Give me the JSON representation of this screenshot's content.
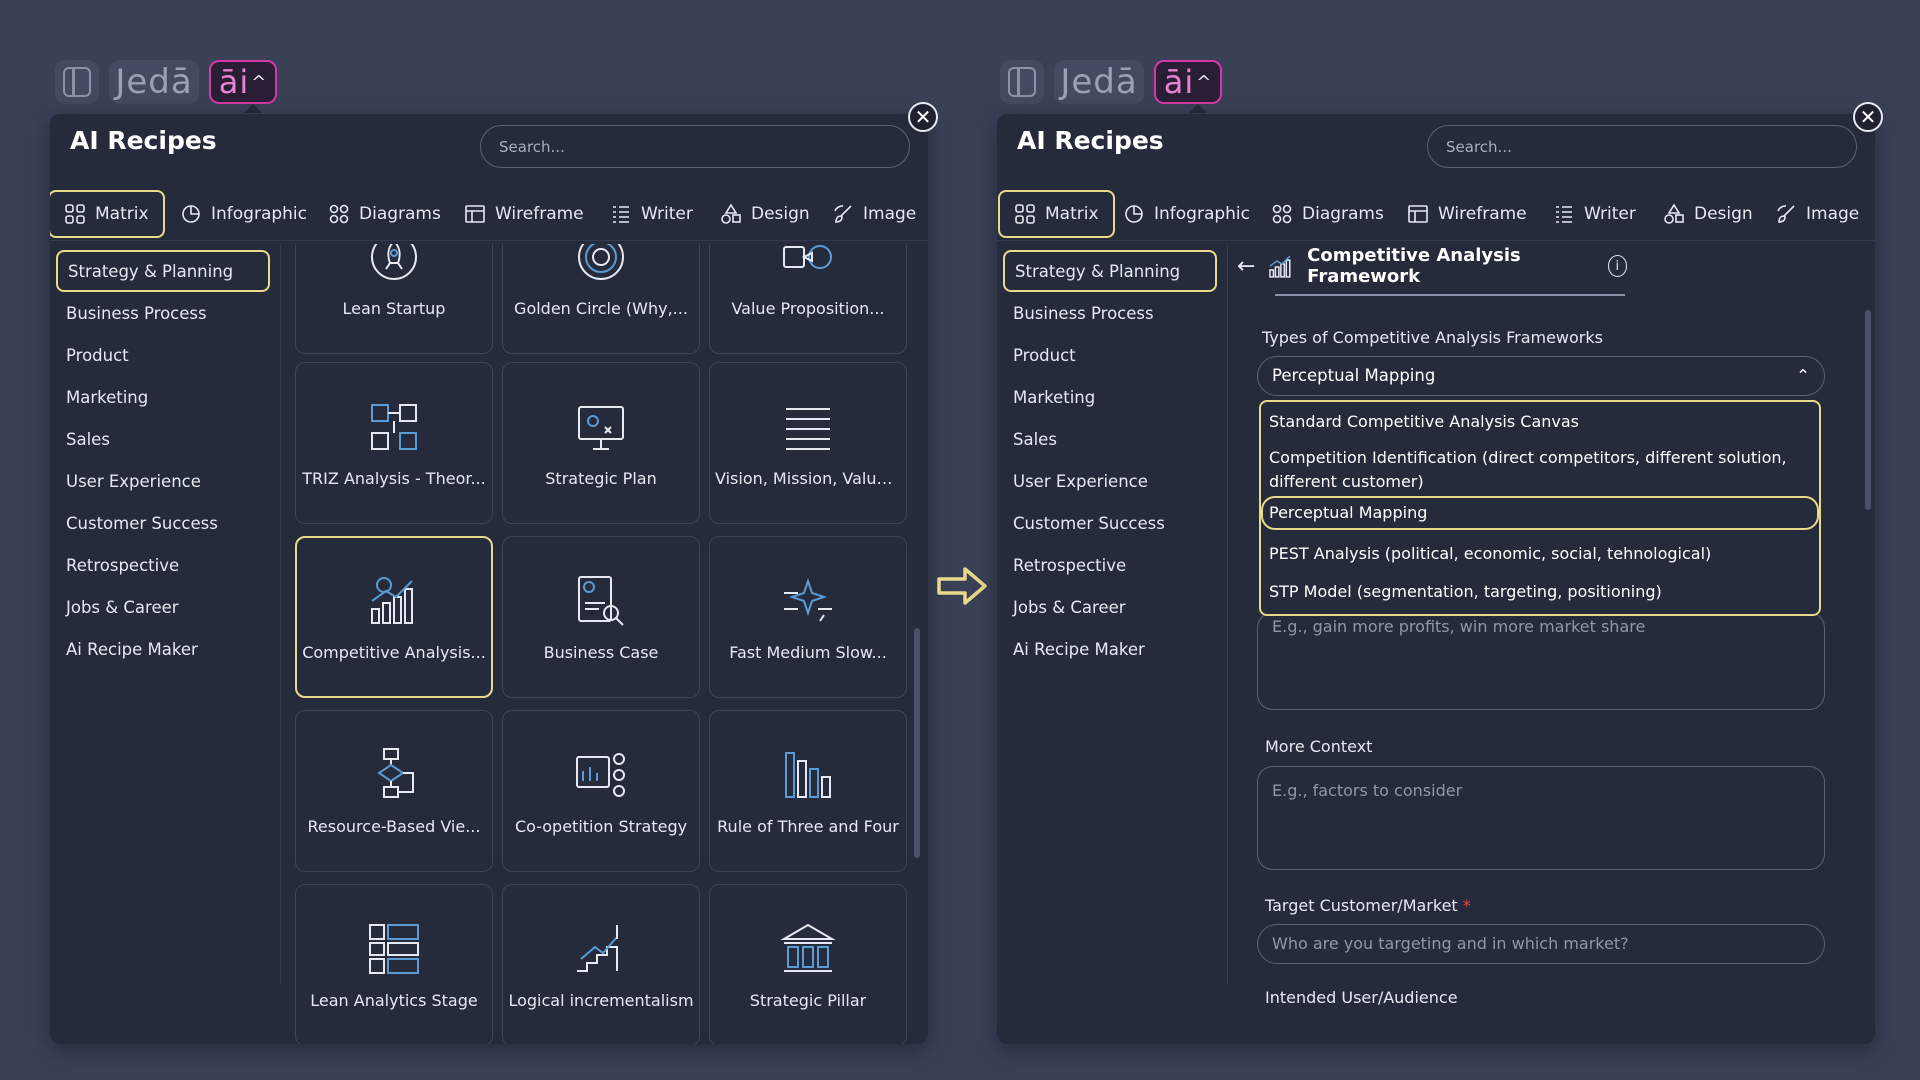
{
  "app": {
    "logo_text": "Jedā",
    "ai_button": "āi",
    "ai_caret": "^"
  },
  "panel_title": "AI Recipes",
  "search_placeholder": "Search...",
  "tabs": [
    {
      "label": "Matrix",
      "icon": "grid-icon"
    },
    {
      "label": "Infographic",
      "icon": "pie-chart-icon"
    },
    {
      "label": "Diagrams",
      "icon": "nodes-icon"
    },
    {
      "label": "Wireframe",
      "icon": "wireframe-icon"
    },
    {
      "label": "Writer",
      "icon": "lines-icon"
    },
    {
      "label": "Design",
      "icon": "shapes-icon"
    },
    {
      "label": "Image",
      "icon": "brush-icon"
    }
  ],
  "categories": [
    "Strategy & Planning",
    "Business Process",
    "Product",
    "Marketing",
    "Sales",
    "User Experience",
    "Customer Success",
    "Retrospective",
    "Jobs & Career",
    "Ai Recipe Maker"
  ],
  "recipes": [
    {
      "label": "Lean Startup",
      "icon": "rocket-icon"
    },
    {
      "label": "Golden Circle (Why,...",
      "icon": "target-circle-icon"
    },
    {
      "label": "Value Proposition...",
      "icon": "value-prop-icon"
    },
    {
      "label": "TRIZ Analysis - Theor...",
      "icon": "triz-icon"
    },
    {
      "label": "Strategic Plan",
      "icon": "strategy-board-icon"
    },
    {
      "label": "Vision, Mission, Value...",
      "icon": "text-lines-icon"
    },
    {
      "label": "Competitive Analysis...",
      "icon": "growth-chart-icon"
    },
    {
      "label": "Business Case",
      "icon": "report-search-icon"
    },
    {
      "label": "Fast Medium Slow...",
      "icon": "sparkle-icon"
    },
    {
      "label": "Resource-Based Vie...",
      "icon": "flowchart-icon"
    },
    {
      "label": "Co-opetition Strategy",
      "icon": "team-board-icon"
    },
    {
      "label": "Rule of Three and Four",
      "icon": "bars-icon"
    },
    {
      "label": "Lean Analytics Stage",
      "icon": "stages-icon"
    },
    {
      "label": "Logical incrementalism",
      "icon": "stairs-icon"
    },
    {
      "label": "Strategic Pillar",
      "icon": "pillar-icon"
    }
  ],
  "detail": {
    "back": "←",
    "title": "Competitive Analysis Framework",
    "info": "i",
    "types_label": "Types of Competitive Analysis Frameworks",
    "selected_type": "Perceptual Mapping",
    "options": [
      "Standard Competitive Analysis Canvas",
      "Competition Identification (direct competitors, different solution, different customer)",
      "Perceptual Mapping",
      "PEST Analysis (political, economic, social, tehnological)",
      "STP Model (segmentation, targeting, positioning)"
    ],
    "goal_placeholder": "E.g., gain more profits, win more market share",
    "more_context_label": "More Context",
    "more_context_placeholder": "E.g., factors to consider",
    "target_label": "Target Customer/Market",
    "required_mark": "*",
    "target_placeholder": "Who are you targeting and in which market?",
    "audience_label": "Intended User/Audience"
  },
  "colors": {
    "background": "#3a4157",
    "panel": "#262b3b",
    "highlight": "#e9d98b",
    "ai_accent": "#d33aa5",
    "icon_blue": "#5b9bd5"
  }
}
